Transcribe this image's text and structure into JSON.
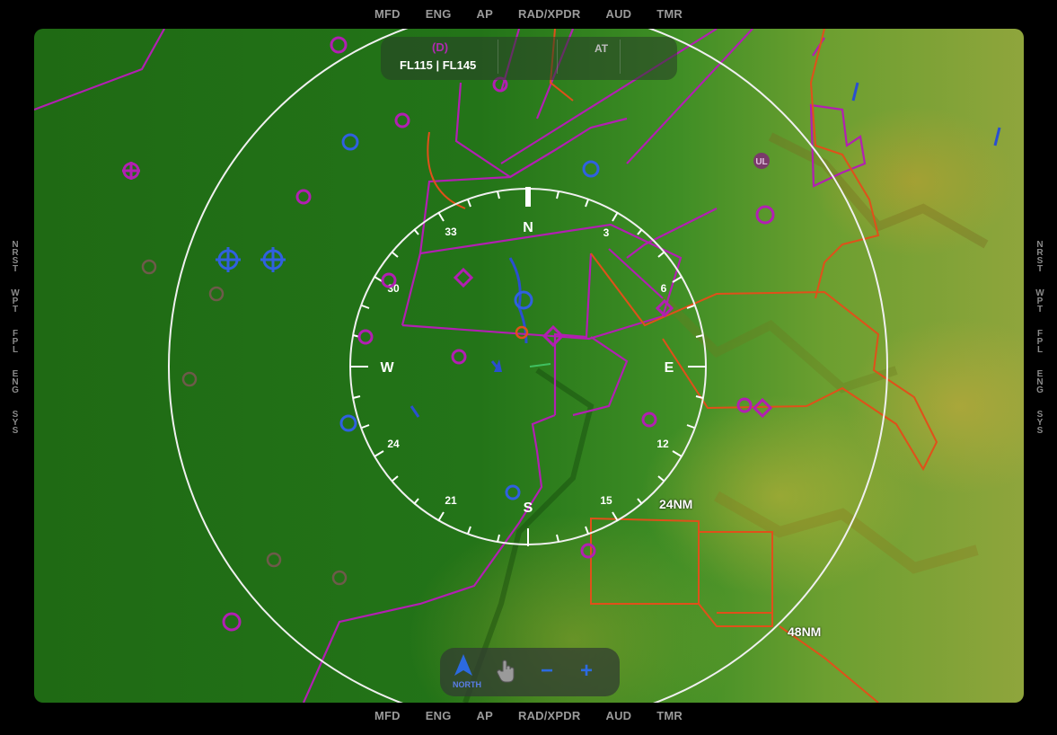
{
  "top_tabs": [
    "MFD",
    "ENG",
    "AP",
    "RAD/XPDR",
    "AUD",
    "TMR"
  ],
  "bottom_tabs": [
    "MFD",
    "ENG",
    "AP",
    "RAD/XPDR",
    "AUD",
    "TMR"
  ],
  "left_sidebar": [
    {
      "letters": [
        "N",
        "R",
        "S",
        "T"
      ]
    },
    {
      "letters": [
        "W",
        "P",
        "T"
      ]
    },
    {
      "letters": [
        "F",
        "P",
        "L"
      ]
    },
    {
      "letters": [
        "E",
        "N",
        "G"
      ]
    },
    {
      "letters": [
        "S",
        "Y",
        "S"
      ]
    }
  ],
  "right_sidebar": [
    {
      "letters": [
        "N",
        "R",
        "S",
        "T"
      ]
    },
    {
      "letters": [
        "W",
        "P",
        "T"
      ]
    },
    {
      "letters": [
        "F",
        "P",
        "L"
      ]
    },
    {
      "letters": [
        "E",
        "N",
        "G"
      ]
    },
    {
      "letters": [
        "S",
        "Y",
        "S"
      ]
    }
  ],
  "altitude_box": {
    "class_label": "(D)",
    "flight_levels": "FL115 | FL145",
    "at_label": "AT"
  },
  "compass": {
    "cardinals": {
      "north": "N",
      "east": "E",
      "south": "S",
      "west": "W"
    },
    "numbers": [
      "3",
      "6",
      "12",
      "15",
      "21",
      "24",
      "30",
      "33"
    ]
  },
  "range_rings": {
    "inner": "24NM",
    "outer": "48NM"
  },
  "map_labels": {
    "airport_ul": "UL"
  },
  "toolbar": {
    "north_label": "NORTH",
    "zoom_out": "−",
    "zoom_in": "+"
  },
  "colors": {
    "airspace": "#b21fb2",
    "restricted": "#e0501a",
    "airport": "#3060e0",
    "terrain_low": "#237418",
    "terrain_high": "#b8a040"
  }
}
